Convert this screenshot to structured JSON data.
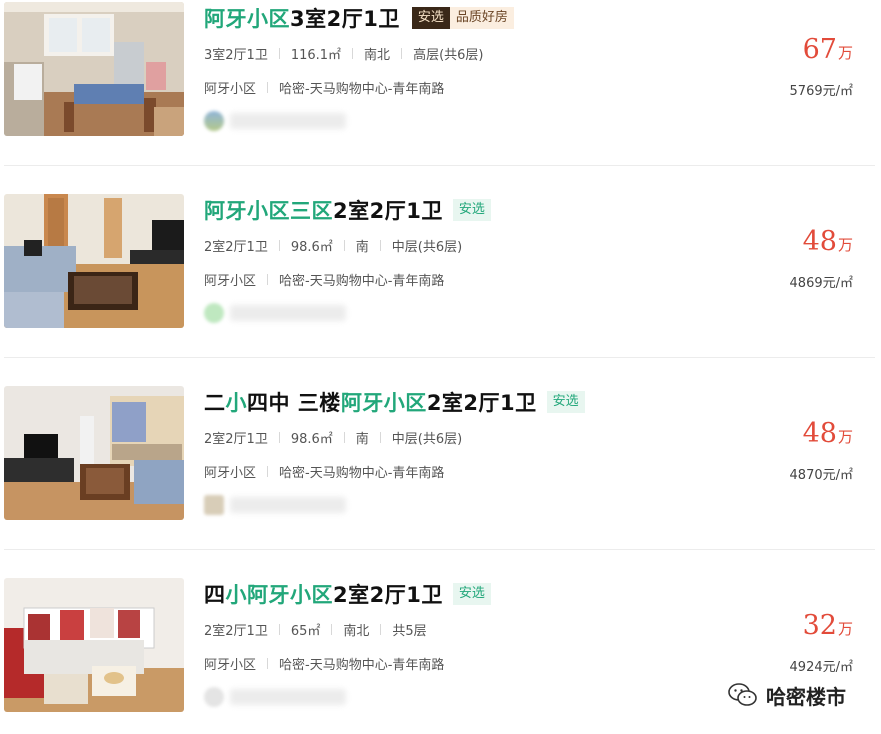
{
  "listings": [
    {
      "title_parts": [
        {
          "text": "阿牙小区",
          "hl": true
        },
        {
          "text": "3室2厅1卫",
          "hl": false
        }
      ],
      "tags": [
        {
          "text": "安选",
          "style": "dark"
        },
        {
          "text": "品质好房",
          "style": "quality"
        }
      ],
      "attributes": [
        "3室2厅1卫",
        "116.1㎡",
        "南北",
        "高层(共6层)"
      ],
      "community": "阿牙小区",
      "area": "哈密-天马购物中心-青年南路",
      "price": "67",
      "price_unit": "万",
      "unit_price": "5769元/㎡",
      "photo_icon": "kitchen-photo"
    },
    {
      "title_parts": [
        {
          "text": "阿牙小区三区",
          "hl": true
        },
        {
          "text": "2室2厅1卫",
          "hl": false
        }
      ],
      "tags": [
        {
          "text": "安选",
          "style": "anxuan"
        }
      ],
      "attributes": [
        "2室2厅1卫",
        "98.6㎡",
        "南",
        "中层(共6层)"
      ],
      "community": "阿牙小区",
      "area": "哈密-天马购物中心-青年南路",
      "price": "48",
      "price_unit": "万",
      "unit_price": "4869元/㎡",
      "photo_icon": "living-room-photo"
    },
    {
      "title_parts": [
        {
          "text": "二",
          "hl": false
        },
        {
          "text": "小",
          "hl": true
        },
        {
          "text": "四中 三楼",
          "hl": false
        },
        {
          "text": "阿牙小区",
          "hl": true
        },
        {
          "text": "2室2厅1卫",
          "hl": false
        }
      ],
      "tags": [
        {
          "text": "安选",
          "style": "anxuan"
        }
      ],
      "attributes": [
        "2室2厅1卫",
        "98.6㎡",
        "南",
        "中层(共6层)"
      ],
      "community": "阿牙小区",
      "area": "哈密-天马购物中心-青年南路",
      "price": "48",
      "price_unit": "万",
      "unit_price": "4870元/㎡",
      "photo_icon": "living-room-photo"
    },
    {
      "title_parts": [
        {
          "text": "四",
          "hl": false
        },
        {
          "text": "小阿牙小区",
          "hl": true
        },
        {
          "text": "2室2厅1卫",
          "hl": false
        }
      ],
      "tags": [
        {
          "text": "安选",
          "style": "anxuan"
        }
      ],
      "attributes": [
        "2室2厅1卫",
        "65㎡",
        "南北",
        "共5层"
      ],
      "community": "阿牙小区",
      "area": "哈密-天马购物中心-青年南路",
      "price": "32",
      "price_unit": "万",
      "unit_price": "4924元/㎡",
      "photo_icon": "sofa-photo"
    }
  ],
  "watermark": {
    "text": "哈密楼市",
    "icon": "wechat-icon"
  },
  "colors": {
    "highlight": "#22a77a",
    "price": "#e24b3a"
  }
}
